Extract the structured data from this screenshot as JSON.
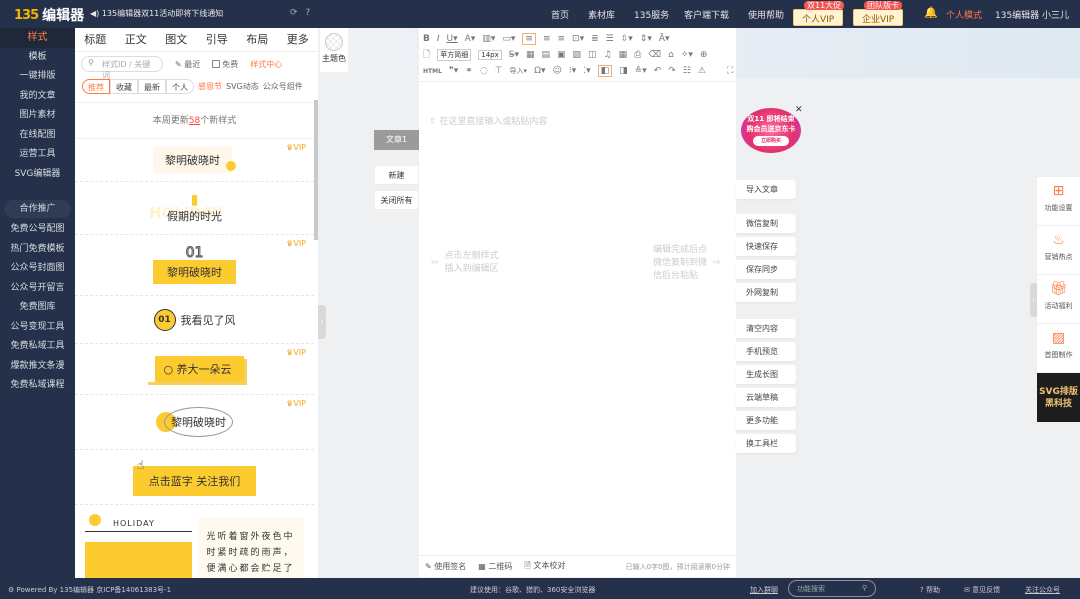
{
  "topbar": {
    "logo_num": "135",
    "logo_text": "编辑器",
    "notice": "◀) 135编辑器双11活动即将下线通知",
    "nav": [
      "首页",
      "素材库",
      "135服务",
      "客户端下载",
      "使用帮助"
    ],
    "vip_personal": "个人VIP",
    "vip_personal_tag": "双11大促",
    "vip_enterprise": "企业VIP",
    "vip_enterprise_tag": "团队版卡",
    "mode": "个人模式",
    "user": "135编辑器 小三儿"
  },
  "sidebar": {
    "items": [
      "样式",
      "模板",
      "一键排版",
      "我的文章",
      "图片素材",
      "在线配图",
      "运营工具",
      "SVG编辑器"
    ],
    "coop": "合作推广",
    "promo_items": [
      "免费公号配图",
      "热门免费模板",
      "公众号封面图",
      "公众号开留言",
      "免费图库",
      "公号变现工具",
      "免费私域工具",
      "爆款推文条漫",
      "免费私域课程"
    ]
  },
  "panel": {
    "tabs": [
      "标题",
      "正文",
      "图文",
      "引导",
      "布局",
      "更多"
    ],
    "search_placeholder": "样式ID / 关键词",
    "recent": "最近",
    "free": "免费",
    "style_center": "样式中心",
    "chips": [
      "推荐",
      "收藏",
      "最新",
      "个人"
    ],
    "extra": [
      "感恩节",
      "SVG动态",
      "公众号组件"
    ],
    "update_pre": "本周更新",
    "update_num": "58",
    "update_post": "个新样式",
    "vip": "VIP",
    "styles": [
      "黎明破晓时",
      "假期的时光",
      "01",
      "黎明破晓时",
      "01",
      "我看见了风",
      "养大一朵云",
      "黎明破晓时",
      "点击蓝字 关注我们",
      "HOLIDAY",
      "光听着窗外夜色中",
      "时紧时疏的雨声，",
      "便满心都会贮足了"
    ],
    "holiday_bg": "HOLIDAY"
  },
  "theme": {
    "label": "主题色"
  },
  "editor": {
    "font": "苹方简细",
    "size": "14px",
    "placeholder": "在这里直接输入或粘贴内容",
    "hint_left": [
      "点击左侧样式",
      "插入到编辑区"
    ],
    "hint_right": [
      "编辑完成后点",
      "微信复制到微",
      "信后台粘贴"
    ],
    "footer": [
      "使用签名",
      "二维码",
      "文本校对"
    ],
    "count": "已输入0字0图，预计阅读需0分钟",
    "toolbar_labels": [
      "HTML",
      "导入"
    ]
  },
  "doc_tabs": [
    "文章1",
    "新建",
    "关闭所有"
  ],
  "actions": [
    "导入文章",
    "微信复制",
    "快速保存",
    "保存同步",
    "外网复制",
    "清空内容",
    "手机预览",
    "生成长图",
    "云端草稿",
    "更多功能",
    "换工具栏"
  ],
  "promo": {
    "line1": "双11 即将结束",
    "line2": "购会员送京东卡",
    "line3": "立即购买"
  },
  "right_panel": [
    "功能设置",
    "营销热点",
    "活动福利",
    "首图制作"
  ],
  "svg_box": [
    "SVG排版",
    "黑科技"
  ],
  "footer": {
    "powered": "Powered By 135编辑器 京ICP备14061383号-1",
    "browser": "建议使用：谷歌、猎豹、360安全浏览器",
    "join": "加入群聊",
    "search_placeholder": "功能搜索",
    "help": "帮助",
    "feedback": "意见反馈",
    "follow": "关注公众号"
  },
  "colors": {
    "nav_bg": "#25314a",
    "accent": "#ff7a45",
    "yellow": "#fccb2f"
  }
}
